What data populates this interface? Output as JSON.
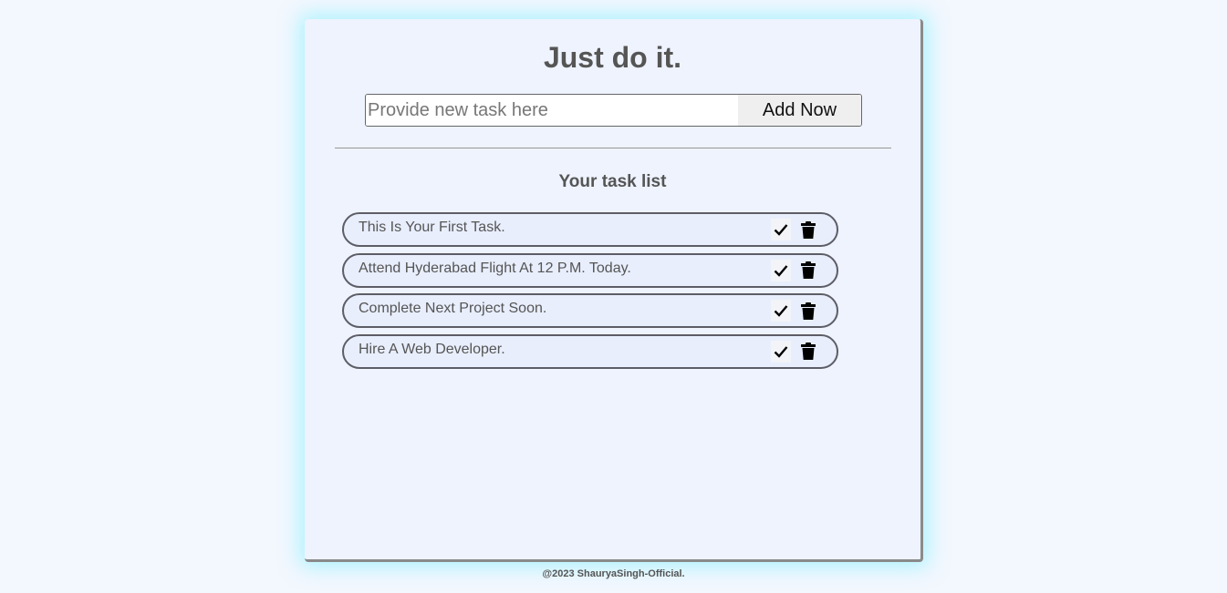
{
  "app": {
    "title": "Just do it."
  },
  "form": {
    "placeholder": "Provide new task here",
    "value": "",
    "add_label": "Add Now"
  },
  "list": {
    "heading": "Your task list",
    "tasks": [
      {
        "text": "This Is Your First Task.",
        "done_icon": "check-icon",
        "delete_icon": "trash-icon"
      },
      {
        "text": "Attend Hyderabad Flight At 12 P.M. Today.",
        "done_icon": "check-icon",
        "delete_icon": "trash-icon"
      },
      {
        "text": "Complete Next Project Soon.",
        "done_icon": "check-icon",
        "delete_icon": "trash-icon"
      },
      {
        "text": "Hire A Web Developer.",
        "done_icon": "check-icon",
        "delete_icon": "trash-icon"
      }
    ]
  },
  "footer": {
    "text": "@2023 ShauryaSingh-Official."
  },
  "colors": {
    "background": "#f3f7fe",
    "card": "#eef3fe",
    "glow": "#78f0ff",
    "text": "#555555"
  }
}
